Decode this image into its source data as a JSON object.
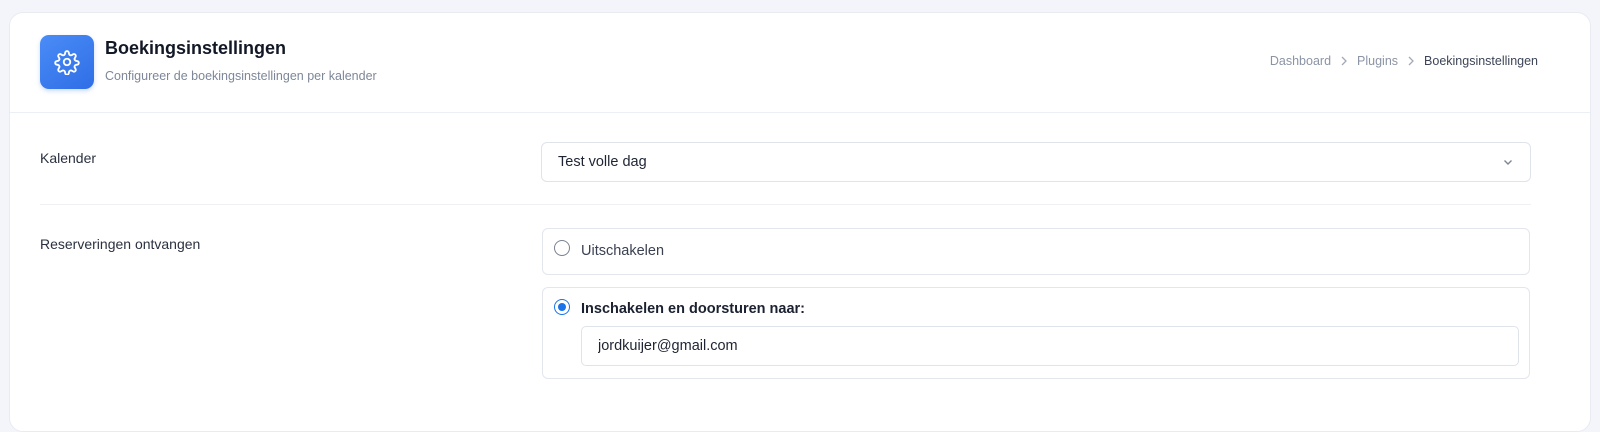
{
  "header": {
    "icon": "gear-icon",
    "title": "Boekingsinstellingen",
    "subtitle": "Configureer de boekingsinstellingen per kalender"
  },
  "breadcrumb": {
    "items": [
      "Dashboard",
      "Plugins",
      "Boekingsinstellingen"
    ]
  },
  "calendar": {
    "label": "Kalender",
    "selected": "Test volle dag"
  },
  "reservations": {
    "label": "Reserveringen ontvangen",
    "options": [
      {
        "label": "Uitschakelen",
        "checked": false
      },
      {
        "label": "Inschakelen en doorsturen naar:",
        "checked": true
      }
    ],
    "email_value": "jordkuijer@gmail.com"
  },
  "colors": {
    "accent": "#2f6ee6",
    "radio_checked": "#1a73e8",
    "background": "#f3f5fa"
  }
}
